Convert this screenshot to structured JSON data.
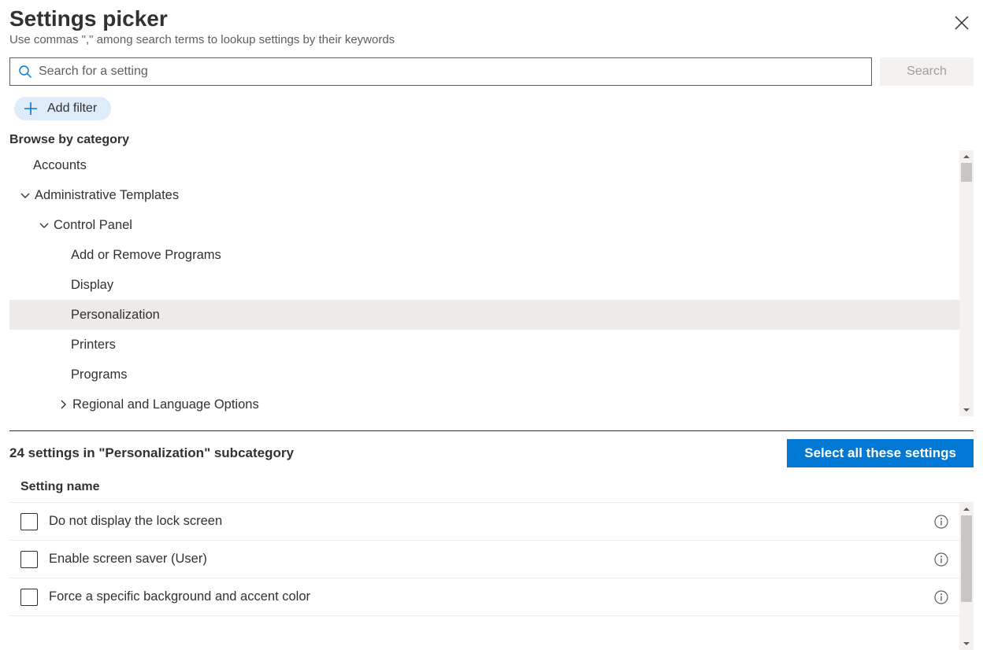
{
  "header": {
    "title": "Settings picker",
    "subtitle": "Use commas \",\" among search terms to lookup settings by their keywords"
  },
  "search": {
    "placeholder": "Search for a setting",
    "button_label": "Search"
  },
  "filter": {
    "add_label": "Add filter"
  },
  "browse": {
    "label": "Browse by category",
    "tree": [
      {
        "label": "Accounts",
        "depth": 0,
        "chevron": null,
        "selected": false
      },
      {
        "label": "Administrative Templates",
        "depth": 1,
        "chevron": "down",
        "selected": false
      },
      {
        "label": "Control Panel",
        "depth": 2,
        "chevron": "down",
        "selected": false
      },
      {
        "label": "Add or Remove Programs",
        "depth": 3,
        "chevron": null,
        "selected": false
      },
      {
        "label": "Display",
        "depth": 3,
        "chevron": null,
        "selected": false
      },
      {
        "label": "Personalization",
        "depth": 3,
        "chevron": null,
        "selected": true
      },
      {
        "label": "Printers",
        "depth": 3,
        "chevron": null,
        "selected": false
      },
      {
        "label": "Programs",
        "depth": 3,
        "chevron": null,
        "selected": false
      },
      {
        "label": "Regional and Language Options",
        "depth": 3,
        "chevron": "right",
        "selected": false
      }
    ]
  },
  "results": {
    "count_label": "24 settings in \"Personalization\" subcategory",
    "select_all_label": "Select all these settings",
    "column_header": "Setting name",
    "items": [
      {
        "label": "Do not display the lock screen"
      },
      {
        "label": "Enable screen saver (User)"
      },
      {
        "label": "Force a specific background and accent color"
      }
    ]
  }
}
